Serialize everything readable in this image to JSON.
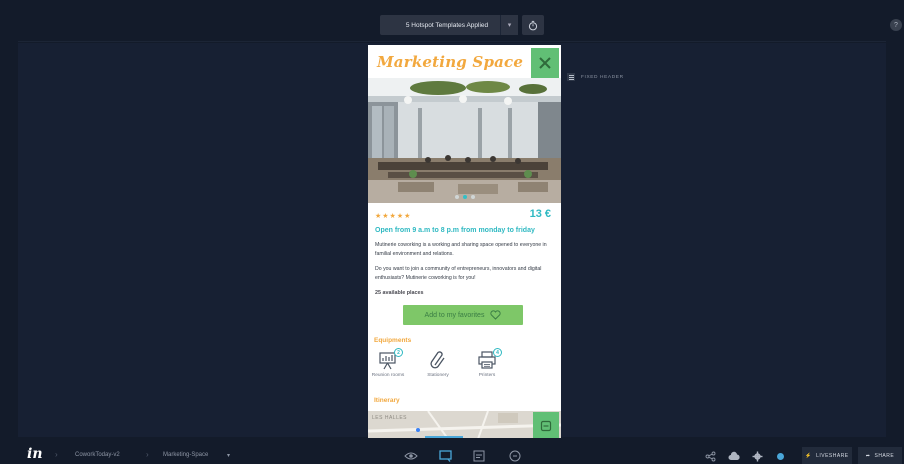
{
  "topbar": {
    "hotspot_label": "5 Hotspot Templates Applied",
    "dropdown_icon": "chevron-down-icon",
    "timer_icon": "stopwatch-icon",
    "help_label": "?"
  },
  "screen": {
    "brand": "Marketing Space",
    "close_icon": "close-icon",
    "carousel": {
      "slides": 3,
      "active": 2
    },
    "rating_stars": "★★★★★",
    "price": "13 €",
    "hours": "Open from 9 a.m to 8 p.m from monday to friday",
    "desc_p1": "Mutinerie coworking is a working and sharing space opened to everyone in familial environment and relations.",
    "desc_p2": "Do you want to join a community of entrepreneurs, innovators and digital enthusiasts? Mutinerie coworking is for you!",
    "places": "25 available places",
    "favorite_button": "Add to my favorites",
    "equipments_title": "Equipments",
    "equipments": [
      {
        "label": "Reunion rooms",
        "count": "2",
        "icon": "projector-screen-icon"
      },
      {
        "label": "Stationery",
        "count": "",
        "icon": "paperclip-icon"
      },
      {
        "label": "Printers",
        "count": "4",
        "icon": "printer-icon"
      }
    ],
    "itinerary_title": "Itinerary",
    "map_label": "LES HALLES"
  },
  "fixed_header_label": "FIXED HEADER",
  "breadcrumb": {
    "logo": "in",
    "project": "CoworkToday-v2",
    "screen": "Marketing-Space",
    "screen_caret": "▾"
  },
  "bottom_tools": [
    "preview-eye-icon",
    "comment-screen-icon",
    "inspect-icon",
    "history-clock-icon"
  ],
  "right_tools": [
    "share-nodes-icon",
    "cloud-upload-icon",
    "gear-icon",
    "status-dot"
  ],
  "liveshare_label": "LIVESHARE",
  "share_label": "SHARE",
  "colors": {
    "accent_orange": "#f2a83e",
    "accent_teal": "#2fb9c2",
    "accent_green": "#61bf75",
    "app_background": "#131b2a"
  }
}
